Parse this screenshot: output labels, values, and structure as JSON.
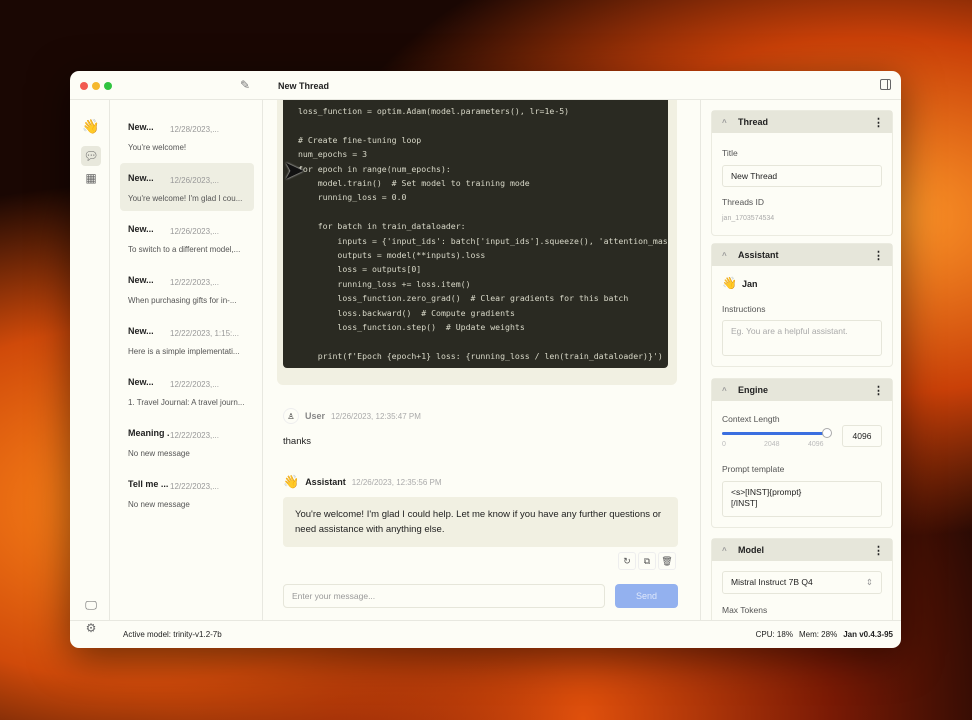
{
  "window": {
    "title": "New Thread"
  },
  "threads": [
    {
      "name": "New...",
      "date": "12/28/2023,...",
      "preview": "You're welcome!"
    },
    {
      "name": "New...",
      "date": "12/26/2023,...",
      "preview": "You're welcome! I'm glad I cou..."
    },
    {
      "name": "New...",
      "date": "12/26/2023,...",
      "preview": "To switch to a different model,..."
    },
    {
      "name": "New...",
      "date": "12/22/2023,...",
      "preview": "When purchasing gifts for in-..."
    },
    {
      "name": "New...",
      "date": "12/22/2023, 1:15:...",
      "preview": "Here is a simple implementati..."
    },
    {
      "name": "New...",
      "date": "12/22/2023,...",
      "preview": "1. Travel Journal: A travel journ..."
    },
    {
      "name": "Meaning ...",
      "date": "12/22/2023,...",
      "preview": "No new message"
    },
    {
      "name": "Tell me ...",
      "date": "12/22/2023,...",
      "preview": "No new message"
    }
  ],
  "code": "loss_function = optim.Adam(model.parameters(), lr=1e-5)\n\n# Create fine-tuning loop\nnum_epochs = 3\nfor epoch in range(num_epochs):\n    model.train()  # Set model to training mode\n    running_loss = 0.0\n\n    for batch in train_dataloader:\n        inputs = {'input_ids': batch['input_ids'].squeeze(), 'attention_mask'\n        outputs = model(**inputs).loss\n        loss = outputs[0]\n        running_loss += loss.item()\n        loss_function.zero_grad()  # Clear gradients for this batch\n        loss.backward()  # Compute gradients\n        loss_function.step()  # Update weights\n\n    print(f'Epoch {epoch+1} loss: {running_loss / len(train_dataloader)}')",
  "messages": {
    "user": {
      "name": "User",
      "time": "12/26/2023, 12:35:47 PM",
      "text": "thanks"
    },
    "assistant": {
      "name": "Assistant",
      "time": "12/26/2023, 12:35:56 PM",
      "text": "You're welcome! I'm glad I could help. Let me know if you have any further questions or need assistance with anything else."
    }
  },
  "composer": {
    "placeholder": "Enter your message...",
    "send": "Send"
  },
  "panel": {
    "thread": {
      "header": "Thread",
      "title_label": "Title",
      "title_value": "New Thread",
      "id_label": "Threads ID",
      "id_value": "jan_1703574534"
    },
    "assistant": {
      "header": "Assistant",
      "name": "Jan",
      "instructions_label": "Instructions",
      "instructions_placeholder": "Eg. You are a helpful assistant."
    },
    "engine": {
      "header": "Engine",
      "context_label": "Context Length",
      "context_value": "4096",
      "slider_fraction": 1.0,
      "ticks": [
        "0",
        "2048",
        "4096"
      ],
      "prompt_label": "Prompt template",
      "prompt_value": "<s>[INST]{prompt}\n[/INST]"
    },
    "model": {
      "header": "Model",
      "selected": "Mistral Instruct 7B Q4",
      "max_tokens_label": "Max Tokens"
    }
  },
  "footer": {
    "active_model": "Active model: trinity-v1.2-7b",
    "cpu": "CPU: 18%",
    "mem": "Mem: 28%",
    "version": "Jan v0.4.3-95"
  },
  "colors": {
    "accent": "#3b6fe0",
    "send": "#93b1ef"
  }
}
